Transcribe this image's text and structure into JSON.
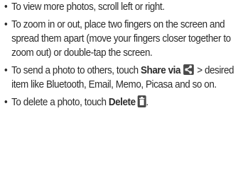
{
  "bullet_glyph": "•",
  "items": [
    {
      "text": "To view more photos, scroll left or right."
    },
    {
      "text": "To zoom in or out, place two fingers on the screen and spread them apart (move your fingers closer together to zoom out) or double-tap the screen."
    },
    {
      "before": "To send a photo to others, touch ",
      "action_label": "Share via",
      "icon": "share-icon",
      "after": " > desired item like Bluetooth, Email, Memo, Picasa and so on."
    },
    {
      "before": "To delete a photo, touch ",
      "action_label": "Delete",
      "icon": "trash-icon",
      "after": "."
    }
  ],
  "colors": {
    "text": "#2b2b2b",
    "icon_bg": "#4a4a4a"
  }
}
